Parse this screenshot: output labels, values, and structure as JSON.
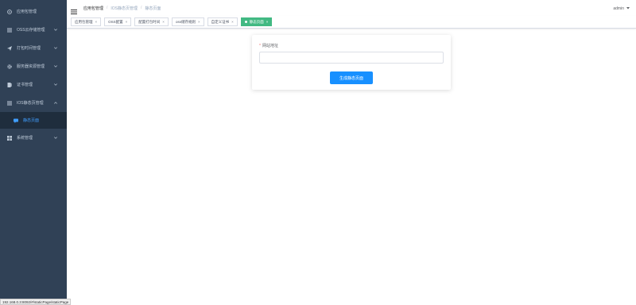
{
  "sidebar": {
    "items": [
      {
        "label": "应用包管理",
        "icon": "app-icon",
        "has_arrow": false
      },
      {
        "label": "OSS云存储管理",
        "icon": "list-icon",
        "has_arrow": true
      },
      {
        "label": "打包时间管理",
        "icon": "send-icon",
        "has_arrow": true
      },
      {
        "label": "服务器资源管理",
        "icon": "gear-icon",
        "has_arrow": true
      },
      {
        "label": "证书管理",
        "icon": "certificate-icon",
        "has_arrow": true
      },
      {
        "label": "IOS静态页管理",
        "icon": "list-icon",
        "has_arrow": true
      }
    ],
    "sub_item": {
      "label": "静态页面",
      "icon": "chat-icon"
    },
    "last_item": {
      "label": "系统管理",
      "icon": "grid-icon"
    }
  },
  "breadcrumb": [
    "应用包管理",
    "IOS静态页管理",
    "静态页面"
  ],
  "user": {
    "name": "admin"
  },
  "tags": [
    {
      "label": "应用包管理",
      "active": false
    },
    {
      "label": "OSS配置",
      "active": false
    },
    {
      "label": "配置打包时间",
      "active": false
    },
    {
      "label": "oss储存规则",
      "active": false
    },
    {
      "label": "自定义证书",
      "active": false
    },
    {
      "label": "静态页面",
      "active": true
    }
  ],
  "form": {
    "label": "网站地址",
    "required_mark": "*",
    "value": "",
    "button_label": "生成静态页面"
  },
  "status_url": "192.168.0.3:8092/#/staticPage/staticPage",
  "colors": {
    "sidebar_bg": "#304156",
    "submenu_bg": "#1f2d3d",
    "active_link": "#409eff",
    "active_tag": "#42b983",
    "primary_button": "#1890ff"
  }
}
